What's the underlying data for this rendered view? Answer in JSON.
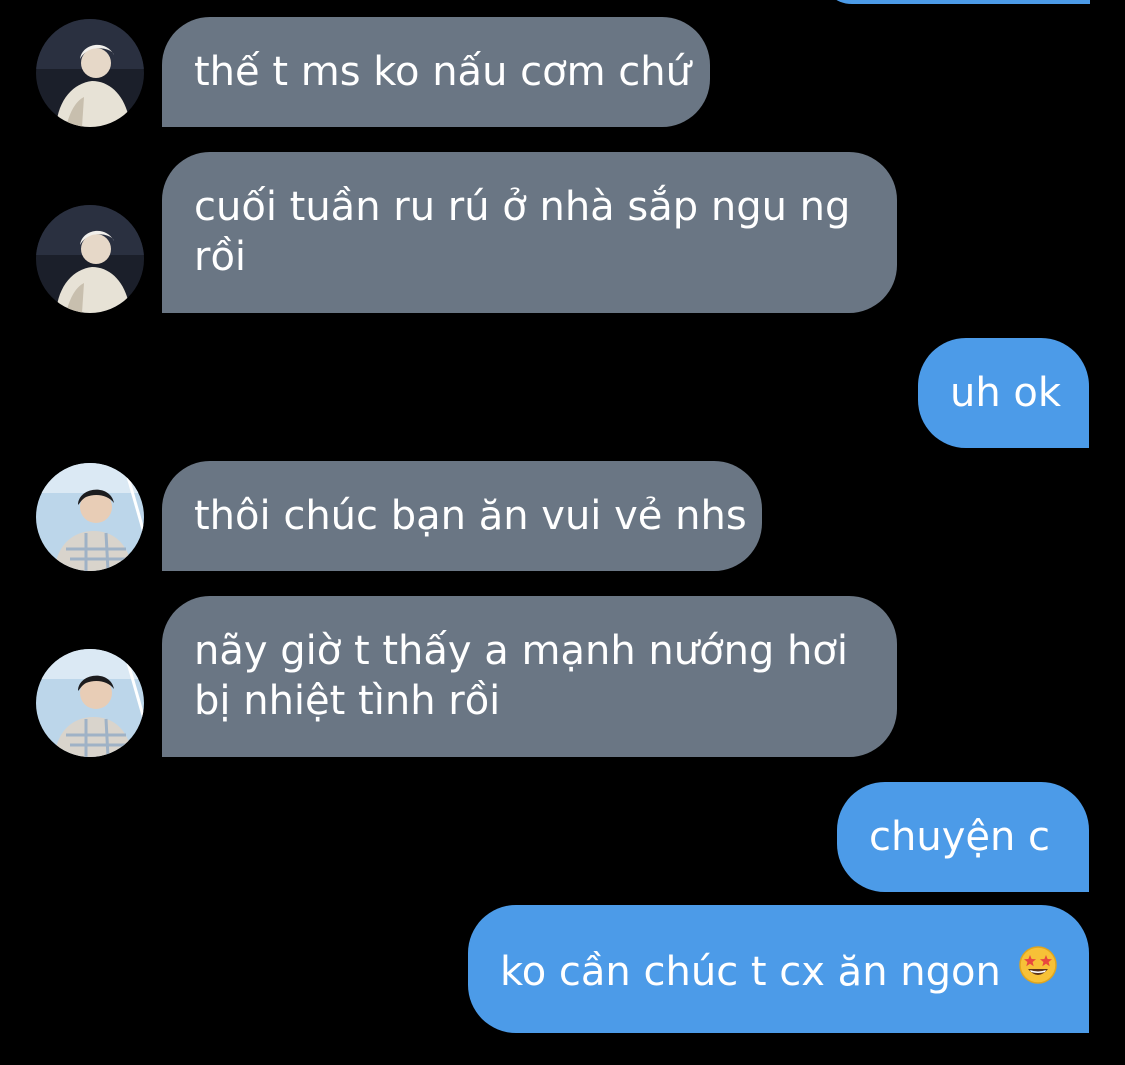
{
  "colors": {
    "background": "#000000",
    "incoming_bubble": "#6a7684",
    "outgoing_bubble": "#4c9be8",
    "text": "#ffffff"
  },
  "messages": [
    {
      "direction": "incoming",
      "avatar": "avatar-white-hair",
      "lines": [
        "thế t ms ko nấu cơm chứ"
      ]
    },
    {
      "direction": "incoming",
      "avatar": "avatar-white-hair",
      "lines": [
        "cuối tuần ru rú ở nhà sắp ngu ng",
        "rồi"
      ]
    },
    {
      "direction": "outgoing",
      "lines": [
        "uh ok"
      ]
    },
    {
      "direction": "incoming",
      "avatar": "avatar-dark-hair",
      "lines": [
        "thôi chúc bạn ăn vui vẻ nhs"
      ]
    },
    {
      "direction": "incoming",
      "avatar": "avatar-dark-hair",
      "lines": [
        "nãy giờ t thấy a mạnh nướng hơi",
        "bị nhiệt tình rồi"
      ]
    },
    {
      "direction": "outgoing",
      "lines": [
        "chuyện c"
      ]
    },
    {
      "direction": "outgoing",
      "lines": [
        "ko cần chúc t cx ăn ngon"
      ],
      "emoji": "star-struck-emoji"
    }
  ]
}
